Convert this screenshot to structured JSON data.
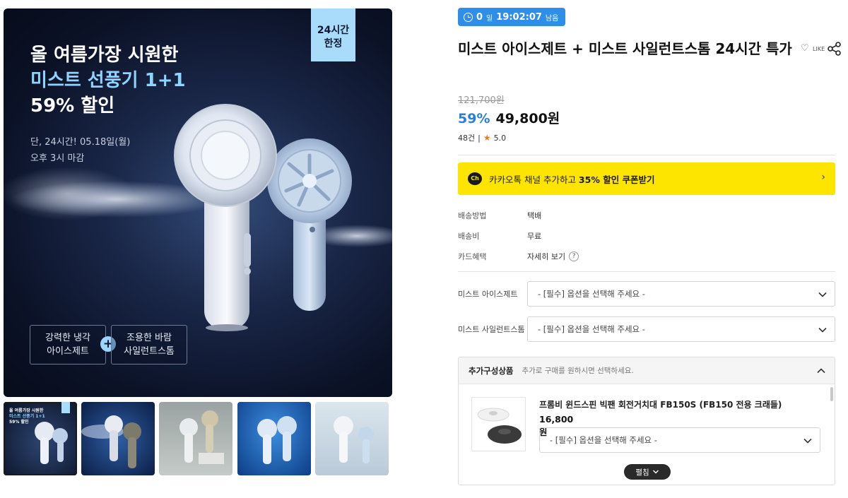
{
  "hero": {
    "title_line1": "올 여름가장 시원한",
    "title_line2": "미스트 선풍기 1+1",
    "title_line3": "59% 할인",
    "sub_line1": "단, 24시간! 05.18일(월)",
    "sub_line2": "오후 3시 마감",
    "ribbon_line1": "24시간",
    "ribbon_line2": "한정",
    "feature1_line1": "강력한 냉각",
    "feature1_line2": "아이스제트",
    "feature_plus": "+",
    "feature2_line1": "조용한 바람",
    "feature2_line2": "사일런트스톰"
  },
  "timer": {
    "days": "0",
    "days_unit": "일",
    "time": "19:02:07",
    "suffix": "남음"
  },
  "product": {
    "title": "미스트 아이스제트 + 미스트 사일런트스톰 24시간 특가",
    "like_label": "LIKE",
    "original_price": "121,700원",
    "discount": "59%",
    "price": "49,800원",
    "review_count": "48건",
    "review_sep": "|",
    "rating": "5.0"
  },
  "kakao": {
    "icon_text": "Ch",
    "text_before": "카카오톡 채널 추가하고 ",
    "text_bold": "35% 할인 쿠폰받기",
    "arrow": "›"
  },
  "info": {
    "shipping_method_label": "배송방법",
    "shipping_method_value": "택배",
    "shipping_fee_label": "배송비",
    "shipping_fee_value": "무료",
    "card_label": "카드혜택",
    "card_value": "자세히 보기",
    "help": "?"
  },
  "options": [
    {
      "label": "미스트 아이스제트",
      "placeholder": "- [필수] 옵션을 선택해 주세요 -"
    },
    {
      "label": "미스트 사일런트스톰",
      "placeholder": "- [필수] 옵션을 선택해 주세요 -"
    }
  ],
  "addon": {
    "title": "추가구성상품",
    "subtitle": "추가로 구매를 원하시면 선택하세요.",
    "item_name": "프롬비 윈드스핀 빅팬 회전거치대 FB150S (FB150 전용 크래들)",
    "item_price": "16,800원",
    "item_select": "- [필수] 옵션을 선택해 주세요 -",
    "fold_label": "펼침"
  },
  "thumbnail_mini_text": [
    "올 여름가장 시원한",
    "미스트 선풍기 1+1",
    "59% 할인"
  ],
  "colors": {
    "accent_blue": "#2a7fdc",
    "timer_blue": "#2f8fe8",
    "kakao_yellow": "#fee500",
    "star_orange": "#f07a1f"
  }
}
